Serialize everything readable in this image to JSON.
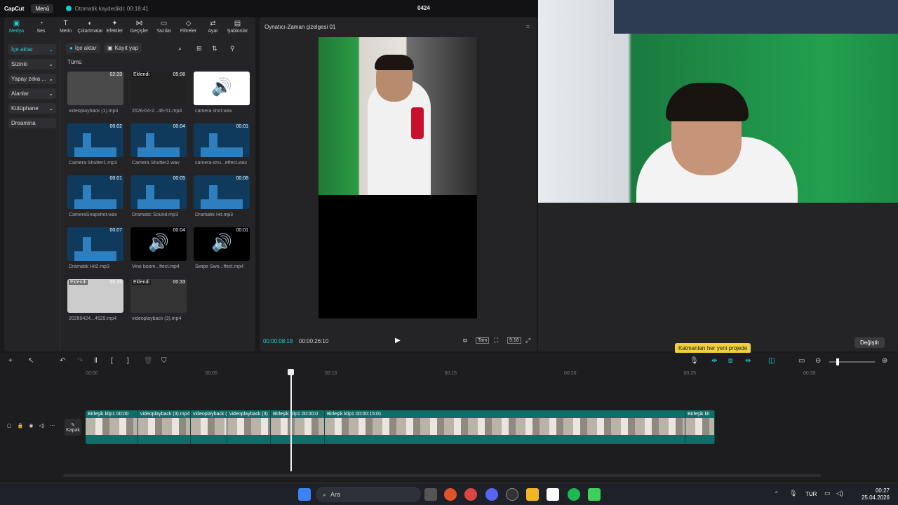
{
  "app": {
    "logo": "CapCut",
    "menu": "Menü",
    "autosave": "Otomatik kaydedildi: 00:18:41",
    "project": "0424"
  },
  "tools": [
    {
      "label": "Medya",
      "icon": "▣"
    },
    {
      "label": "Ses",
      "icon": "◔"
    },
    {
      "label": "Metin",
      "icon": "T"
    },
    {
      "label": "Çıkartmalar",
      "icon": "◐"
    },
    {
      "label": "Efektler",
      "icon": "✦"
    },
    {
      "label": "Geçişler",
      "icon": "⋈"
    },
    {
      "label": "Yazılar",
      "icon": "▭"
    },
    {
      "label": "Filtreler",
      "icon": "◇"
    },
    {
      "label": "Ayar",
      "icon": "⇄"
    },
    {
      "label": "Şablonlar",
      "icon": "▤"
    }
  ],
  "sidebar": [
    "İçe aktar",
    "Sizinki",
    "Yapay zeka ...",
    "Alanlar",
    "Kütüphane",
    "Dreamina"
  ],
  "media": {
    "import": "İçe aktar",
    "record": "Kayıt yap",
    "all": "Tümü",
    "items": [
      {
        "name": "videoplayback (1).mp4",
        "dur": "02:33",
        "tag": ""
      },
      {
        "name": "2026-04-2...46-51.mp4",
        "dur": "05:08",
        "tag": "Eklendi"
      },
      {
        "name": "camera shot.wav",
        "dur": "",
        "tag": ""
      },
      {
        "name": "Camera Shutter1.mp3",
        "dur": "00:02",
        "tag": ""
      },
      {
        "name": "Camera Shutter2.wav",
        "dur": "00:04",
        "tag": ""
      },
      {
        "name": "camera-shu...effect.wav",
        "dur": "00:01",
        "tag": ""
      },
      {
        "name": "CameraSnapshot.wav",
        "dur": "00:01",
        "tag": ""
      },
      {
        "name": "Dramatic Sound.mp3",
        "dur": "00:05",
        "tag": ""
      },
      {
        "name": "Dramatik Hit.mp3",
        "dur": "00:08",
        "tag": ""
      },
      {
        "name": "Dramatik Hit2.mp3",
        "dur": "00:07",
        "tag": ""
      },
      {
        "name": "Vine boom...ffect.mp4",
        "dur": "00:04",
        "tag": ""
      },
      {
        "name": "Swipe Swo...ffect.mp4",
        "dur": "00:01",
        "tag": ""
      },
      {
        "name": "20260424...4629.mp4",
        "dur": "05:26",
        "tag": "Eklendi"
      },
      {
        "name": "videoplayback (3).mp4",
        "dur": "00:33",
        "tag": "Eklendi"
      }
    ]
  },
  "player": {
    "title": "Oynatıcı-Zaman çizelgesi 01",
    "current": "00:00:08:18",
    "total": "00:00:26:10",
    "full": "Tam",
    "ratio": "9:16"
  },
  "props": {
    "hint": "Katmanları her yeni projede",
    "change": "Değiştir"
  },
  "timeline": {
    "ticks": [
      "00:00",
      "00:05",
      "00:10",
      "00:15",
      "00:20",
      "00:25",
      "00:30"
    ],
    "cover": "Kapak",
    "clips": [
      "Birleşik klip1  00:00",
      "videoplayback (3).mp4",
      "videoplayback (",
      "videoplayback (3)",
      "Birleşik klip1  00:00:0",
      "Birleşik klip1  00:00:15:01",
      "Birleşik kli"
    ]
  },
  "taskbar": {
    "search": "Ara",
    "lang": "TUR",
    "time": "00:27",
    "date": "25.04.2026"
  }
}
